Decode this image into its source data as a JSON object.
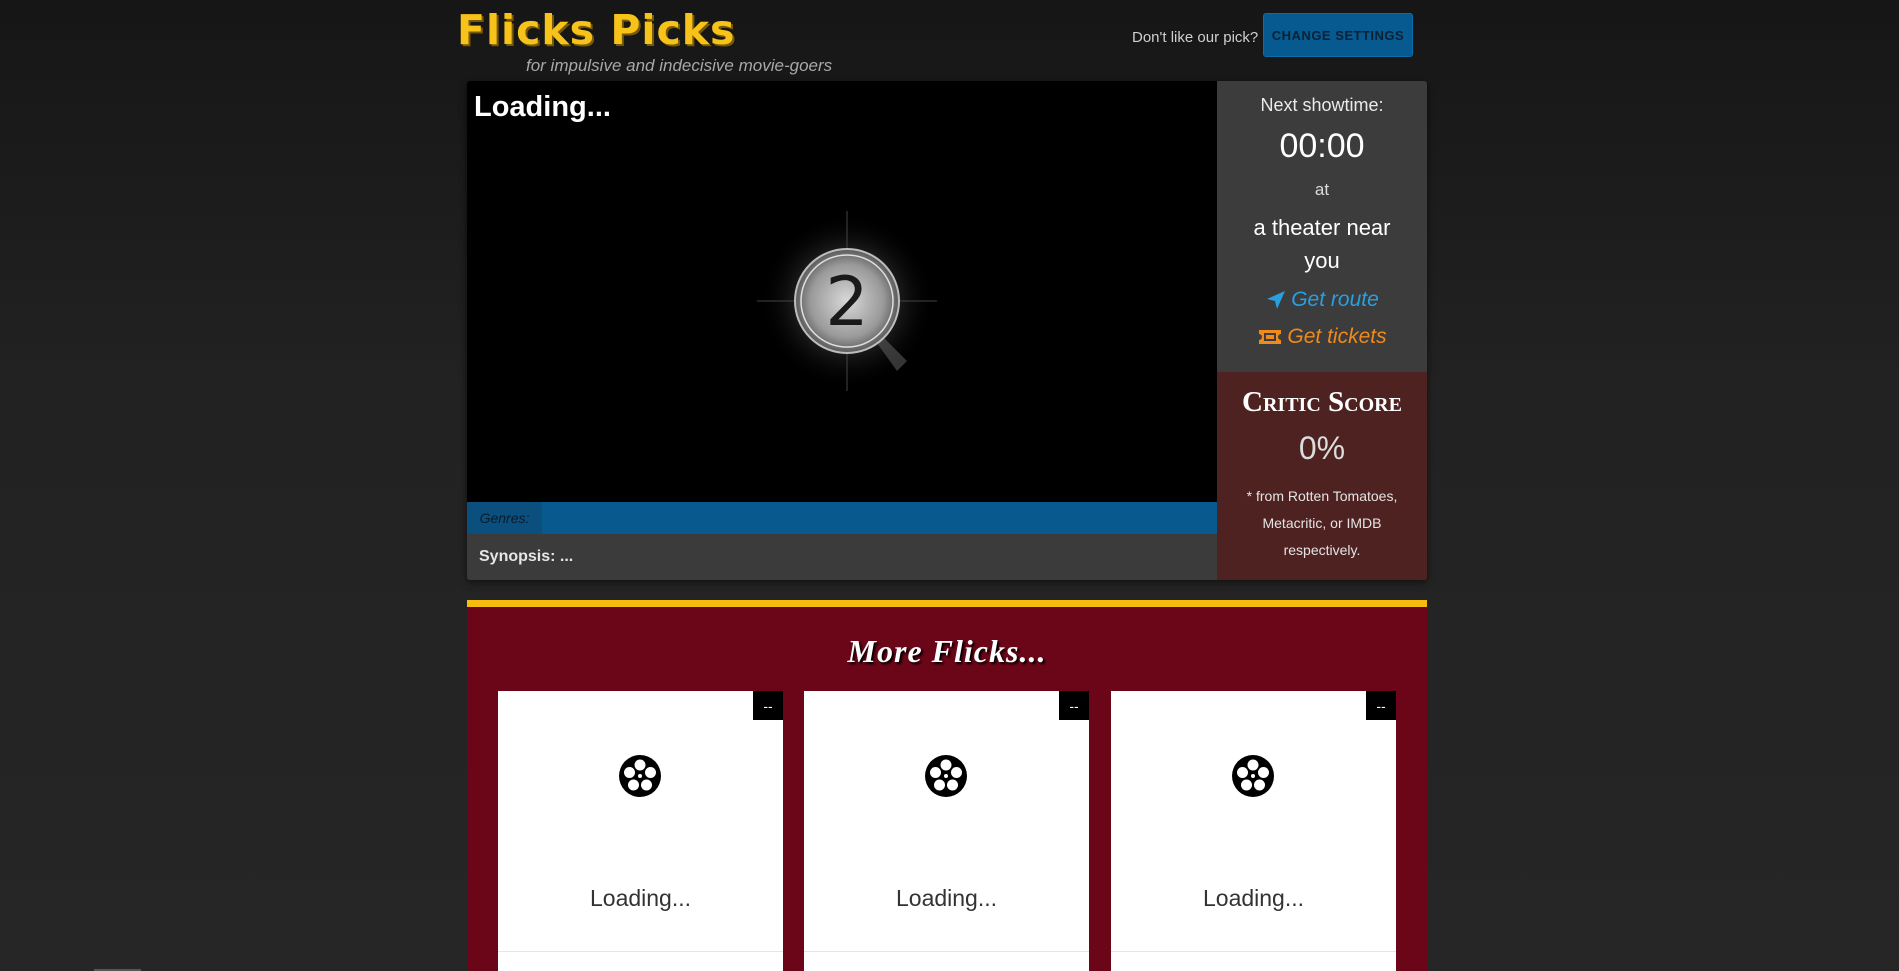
{
  "header": {
    "brand": "Flicks Picks",
    "tagline": "for impulsive and indecisive movie-goers",
    "dislike_text": "Don't like our pick?",
    "change_settings_label": "CHANGE SETTINGS"
  },
  "feature": {
    "title": "Loading...",
    "countdown_number": "2",
    "genres_label": "Genres:",
    "synopsis": "Synopsis: ..."
  },
  "showtime": {
    "label": "Next showtime:",
    "time": "00:00",
    "at": "at",
    "theater": "a theater near you",
    "route_label": "Get route",
    "tickets_label": "Get tickets"
  },
  "critic": {
    "title": "Critic Score",
    "score": "0%",
    "note": "* from Rotten Tomatoes, Metacritic, or IMDB respectively."
  },
  "more": {
    "title": "More Flicks...",
    "cards": [
      {
        "badge": "--",
        "text": "Loading...",
        "icon": "film-reel-icon"
      },
      {
        "badge": "--",
        "text": "Loading...",
        "icon": "film-reel-icon"
      },
      {
        "badge": "--",
        "text": "Loading...",
        "icon": "film-reel-icon"
      }
    ]
  },
  "colors": {
    "brand_yellow": "#f7c21a",
    "settings_blue": "#075a8f",
    "route_blue": "#2a9fe0",
    "tickets_orange": "#f08a1c",
    "critic_bg": "#4f2222",
    "more_bg": "#6a0618"
  }
}
